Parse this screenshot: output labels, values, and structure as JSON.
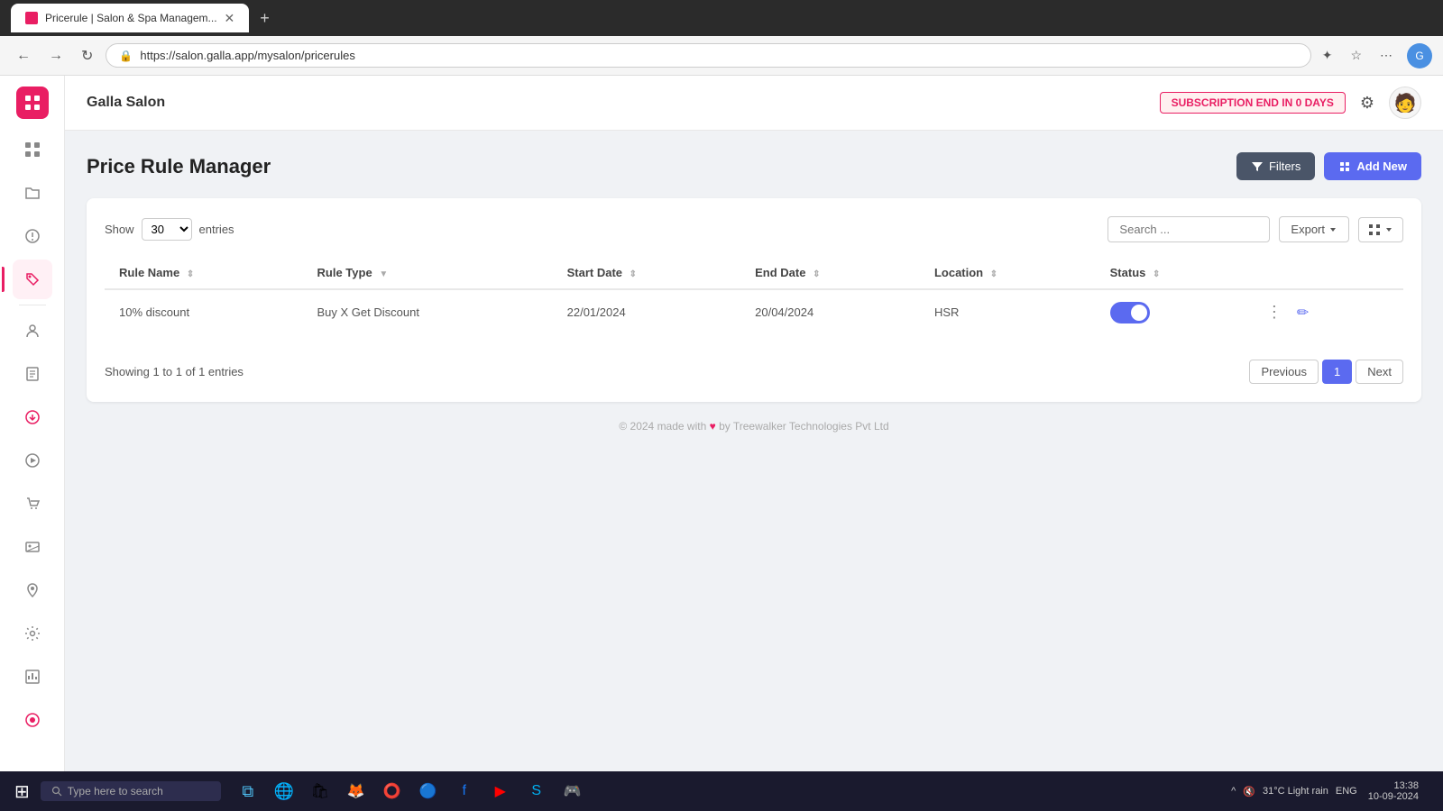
{
  "browser": {
    "tab_title": "Pricerule | Salon & Spa Managem...",
    "url": "https://salon.galla.app/mysalon/pricerules",
    "tab_close": "✕",
    "tab_new": "+"
  },
  "header": {
    "salon_name": "Galla Salon",
    "subscription_badge": "SUBSCRIPTION END IN 0 DAYS",
    "user_icon": "👤"
  },
  "page": {
    "title": "Price Rule Manager",
    "filters_label": "Filters",
    "add_new_label": "Add New"
  },
  "table_controls": {
    "show_label": "Show",
    "entries_value": "30",
    "entries_label": "entries",
    "search_placeholder": "Search ...",
    "export_label": "Export"
  },
  "table": {
    "columns": [
      {
        "key": "rule_name",
        "label": "Rule Name"
      },
      {
        "key": "rule_type",
        "label": "Rule Type"
      },
      {
        "key": "start_date",
        "label": "Start Date"
      },
      {
        "key": "end_date",
        "label": "End Date"
      },
      {
        "key": "location",
        "label": "Location"
      },
      {
        "key": "status",
        "label": "Status"
      }
    ],
    "rows": [
      {
        "rule_name": "10% discount",
        "rule_type": "Buy X Get Discount",
        "start_date": "22/01/2024",
        "end_date": "20/04/2024",
        "location": "HSR",
        "status_active": true
      }
    ]
  },
  "pagination": {
    "showing_text": "Showing 1 to 1 of 1 entries",
    "previous_label": "Previous",
    "page_1": "1",
    "next_label": "Next"
  },
  "footer": {
    "text": "© 2024 made with",
    "by_text": "by Treewalker Technologies Pvt Ltd"
  },
  "taskbar": {
    "search_placeholder": "Type here to search",
    "time": "13:38",
    "date": "10-09-2024",
    "weather": "31°C  Light rain",
    "lang": "ENG"
  },
  "sidebar": {
    "items": [
      {
        "icon": "⊞",
        "name": "dashboard"
      },
      {
        "icon": "📁",
        "name": "folder"
      },
      {
        "icon": "⚠",
        "name": "alert"
      },
      {
        "icon": "🏷",
        "name": "price-rules",
        "active": true
      },
      {
        "icon": "👤",
        "name": "users"
      },
      {
        "icon": "📄",
        "name": "reports"
      },
      {
        "icon": "⬇",
        "name": "download"
      },
      {
        "icon": "▶",
        "name": "play"
      },
      {
        "icon": "🛒",
        "name": "orders"
      },
      {
        "icon": "🖼",
        "name": "gallery"
      },
      {
        "icon": "📍",
        "name": "location"
      },
      {
        "icon": "⚙",
        "name": "settings"
      },
      {
        "icon": "📊",
        "name": "analytics"
      },
      {
        "icon": "🎯",
        "name": "target"
      },
      {
        "icon": "🔴",
        "name": "record"
      }
    ]
  }
}
